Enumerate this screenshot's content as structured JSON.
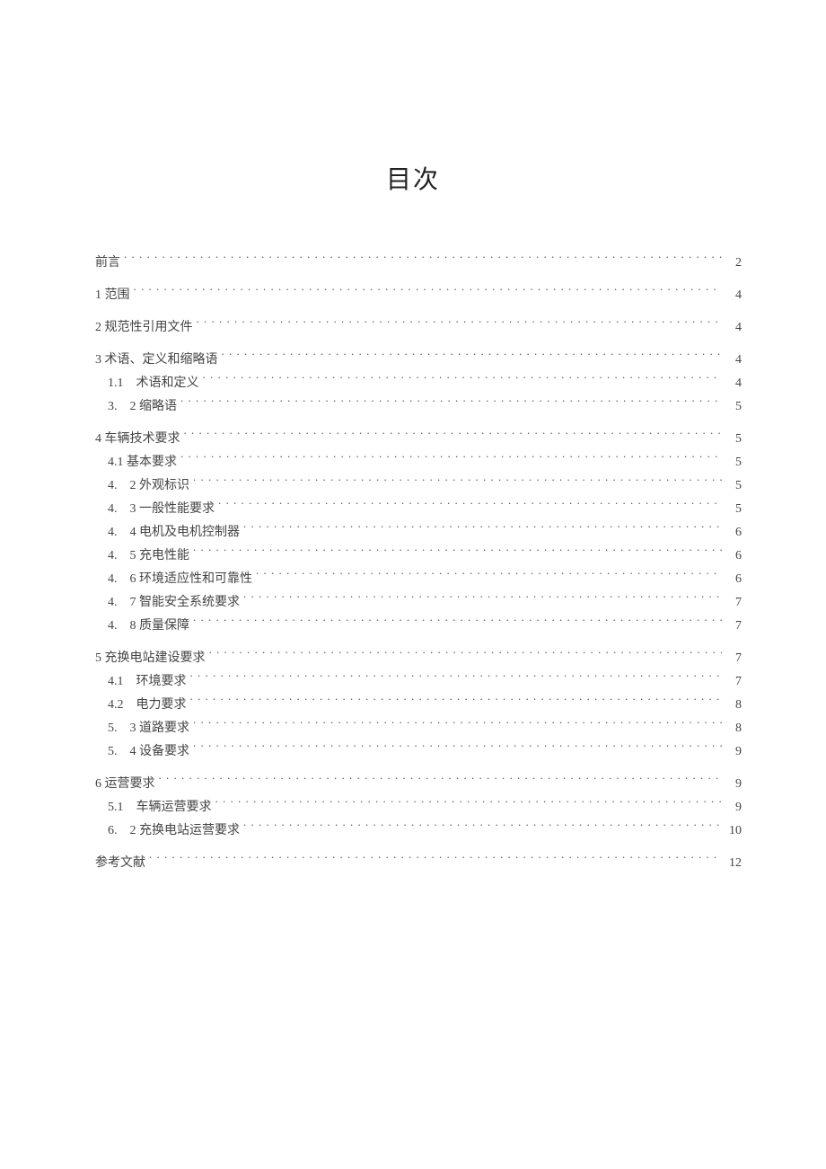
{
  "title": "目次",
  "toc": [
    {
      "label": "前言",
      "page": "2",
      "indent": 0,
      "gap": false
    },
    {
      "label": "1 范围",
      "page": "4",
      "indent": 0,
      "gap": true
    },
    {
      "label": "2 规范性引用文件",
      "page": "4",
      "indent": 0,
      "gap": true
    },
    {
      "label": "3 术语、定义和缩略语",
      "page": "4",
      "indent": 0,
      "gap": true
    },
    {
      "label": "1.1　术语和定义",
      "page": "4",
      "indent": 1,
      "gap": false
    },
    {
      "label": "3.　2 缩略语",
      "page": "5",
      "indent": 1,
      "gap": false
    },
    {
      "label": "4 车辆技术要求",
      "page": "5",
      "indent": 0,
      "gap": true
    },
    {
      "label": "4.1 基本要求",
      "page": "5",
      "indent": 1,
      "gap": false
    },
    {
      "label": "4.　2 外观标识",
      "page": "5",
      "indent": 1,
      "gap": false
    },
    {
      "label": "4.　3 一般性能要求",
      "page": "5",
      "indent": 1,
      "gap": false
    },
    {
      "label": "4.　4 电机及电机控制器",
      "page": "6",
      "indent": 1,
      "gap": false
    },
    {
      "label": "4.　5 充电性能",
      "page": "6",
      "indent": 1,
      "gap": false
    },
    {
      "label": "4.　6 环境适应性和可靠性",
      "page": "6",
      "indent": 1,
      "gap": false
    },
    {
      "label": "4.　7 智能安全系统要求",
      "page": "7",
      "indent": 1,
      "gap": false
    },
    {
      "label": "4.　8 质量保障",
      "page": "7",
      "indent": 1,
      "gap": false
    },
    {
      "label": "5 充换电站建设要求",
      "page": "7",
      "indent": 0,
      "gap": true
    },
    {
      "label": "4.1　环境要求",
      "page": "7",
      "indent": 1,
      "gap": false
    },
    {
      "label": "4.2　电力要求",
      "page": "8",
      "indent": 1,
      "gap": false
    },
    {
      "label": "5.　3 道路要求",
      "page": "8",
      "indent": 1,
      "gap": false
    },
    {
      "label": "5.　4 设备要求",
      "page": "9",
      "indent": 1,
      "gap": false
    },
    {
      "label": "6 运营要求",
      "page": "9",
      "indent": 0,
      "gap": true
    },
    {
      "label": "5.1　车辆运营要求",
      "page": "9",
      "indent": 1,
      "gap": false
    },
    {
      "label": "6.　2 充换电站运营要求",
      "page": "10",
      "indent": 1,
      "gap": false
    },
    {
      "label": "参考文献",
      "page": "12",
      "indent": 0,
      "gap": true
    }
  ]
}
